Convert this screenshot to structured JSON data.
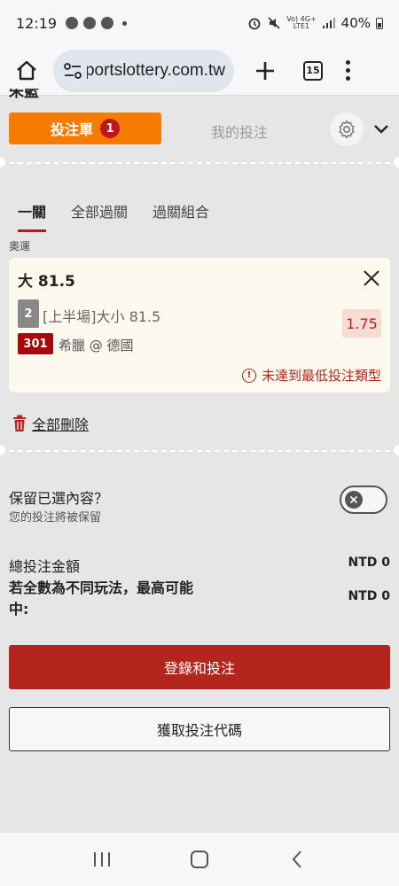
{
  "status_bar": {
    "time": "12:19",
    "net_top": "Vo) 4G+",
    "net_bottom": "LTE1",
    "battery": "40%"
  },
  "browser": {
    "url": "sportslottery.com.tw",
    "tab_count": "15"
  },
  "page": {
    "cutoff_header": "朱籃"
  },
  "betslip": {
    "tab_betslip": "投注單",
    "badge_count": "1",
    "tab_my_bets": "我的投注"
  },
  "bet_tabs": [
    {
      "label": "一關"
    },
    {
      "label": "全部過關"
    },
    {
      "label": "過關組合"
    }
  ],
  "category": "奧運",
  "selection": {
    "title": "大 81.5",
    "market_number": "2",
    "market": "[上半場]大小 81.5",
    "match_number": "301",
    "match": "希臘 @ 德國",
    "odds": "1.75",
    "warning": "未達到最低投注類型"
  },
  "delete_all": "全部刪除",
  "keep": {
    "title": "保留已選內容？",
    "subtitle": "您的投注將被保留"
  },
  "totals": {
    "total_label": "總投注金額",
    "total_value": "NTD 0",
    "max_win_label": "若全數為不同玩法，最高可能中:",
    "max_win_value": "NTD 0"
  },
  "buttons": {
    "login_bet": "登錄和投注",
    "get_code": "獲取投注代碼"
  },
  "colors": {
    "accent_orange": "#f57c00",
    "brand_red": "#b3261e",
    "background": "#e6e6e6"
  }
}
